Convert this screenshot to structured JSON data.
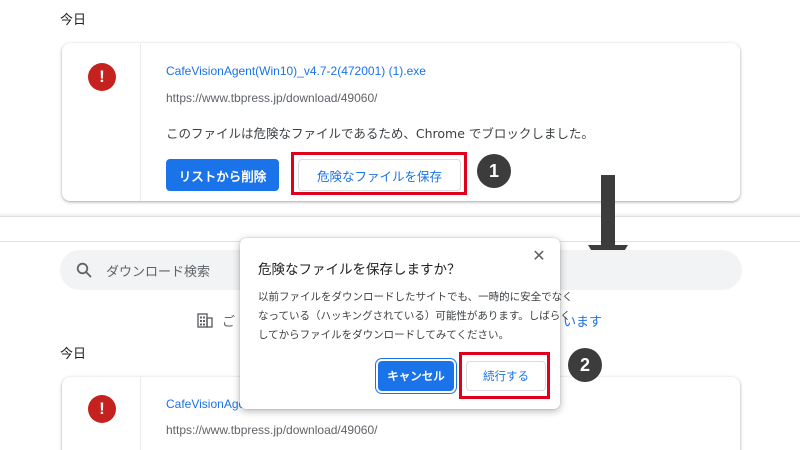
{
  "top": {
    "section_label": "今日",
    "item": {
      "filename": "CafeVisionAgent(Win10)_v4.7-2(472001) (1).exe",
      "url": "https://www.tbpress.jp/download/49060/",
      "message": "このファイルは危険なファイルであるため、Chrome でブロックしました。",
      "remove_label": "リストから削除",
      "keep_label": "危険なファイルを保存"
    },
    "step1": "1"
  },
  "bottom": {
    "search_placeholder": "ダウンロード検索",
    "org_text_left": "ご",
    "org_text_right": "います",
    "section_label": "今日",
    "item": {
      "filename": "CafeVisionAgent",
      "url": "https://www.tbpress.jp/download/49060/"
    }
  },
  "dialog": {
    "title": "危険なファイルを保存しますか？",
    "body_lines": [
      "以前ファイルをダウンロードしたサイトでも、一時的に安全でなく",
      "なっている（ハッキングされている）可能性があります。しばらく",
      "してからファイルをダウンロードしてみてください。"
    ],
    "cancel_label": "キャンセル",
    "continue_label": "続行する",
    "step2": "2"
  },
  "colors": {
    "accent": "#1a73e8",
    "danger": "#c5221f",
    "highlight": "#e0001b",
    "step_badge": "#3c3c3c"
  },
  "icons": {
    "danger": "exclamation-circle-icon",
    "search": "search-icon",
    "org": "building-icon",
    "close": "close-icon",
    "arrow": "arrow-down-icon"
  }
}
